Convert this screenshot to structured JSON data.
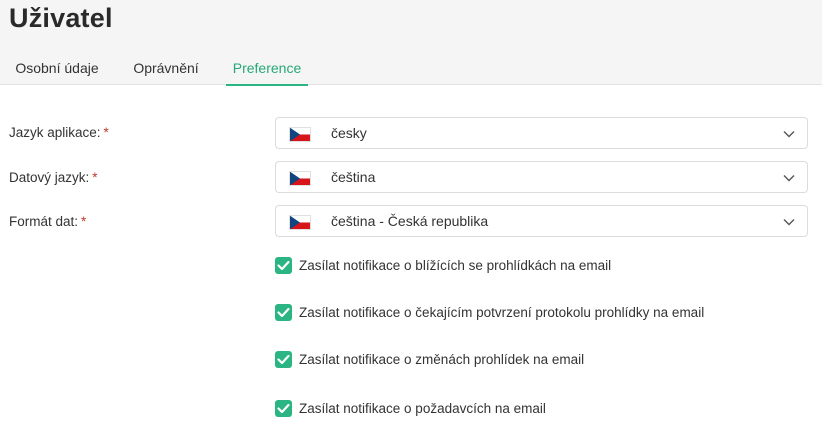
{
  "page": {
    "title": "Uživatel"
  },
  "tabs": [
    {
      "label": "Osobní údaje",
      "active": false
    },
    {
      "label": "Oprávnění",
      "active": false
    },
    {
      "label": "Preference",
      "active": true
    }
  ],
  "form": {
    "required_mark": "*",
    "app_language": {
      "label": "Jazyk aplikace:",
      "value": "česky",
      "flag_icon": "czech-flag-icon"
    },
    "data_language": {
      "label": "Datový jazyk:",
      "value": "čeština",
      "flag_icon": "czech-flag-icon"
    },
    "data_format": {
      "label": "Formát dat:",
      "value": "čeština - Česká republika",
      "flag_icon": "czech-flag-icon"
    }
  },
  "notifications": [
    {
      "label": "Zasílat notifikace o blížících se prohlídkách na email",
      "checked": true
    },
    {
      "label": "Zasílat notifikace o čekajícím potvrzení protokolu prohlídky na email",
      "checked": true
    },
    {
      "label": "Zasílat notifikace o změnách prohlídek na email",
      "checked": true
    },
    {
      "label": "Zasílat notifikace o požadavcích na email",
      "checked": true
    }
  ],
  "colors": {
    "accent": "#2bb583",
    "required": "#c0392b",
    "header_bg": "#f5f5f6"
  }
}
